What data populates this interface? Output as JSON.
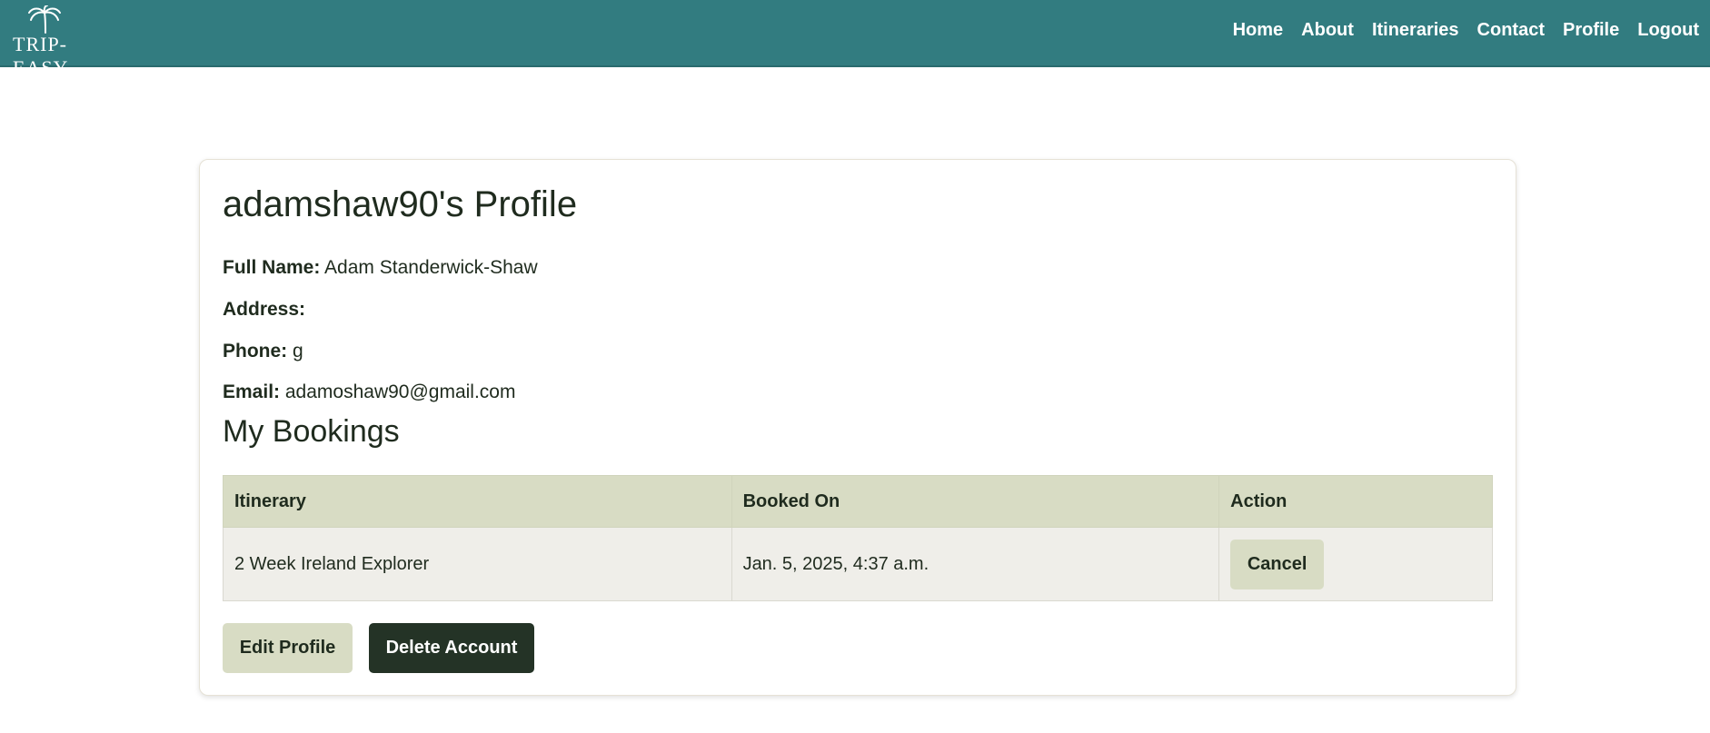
{
  "brand": {
    "logo_text": "TRIP-EASY"
  },
  "nav": {
    "items": [
      {
        "label": "Home"
      },
      {
        "label": "About"
      },
      {
        "label": "Itineraries"
      },
      {
        "label": "Contact"
      },
      {
        "label": "Profile"
      },
      {
        "label": "Logout"
      }
    ]
  },
  "profile": {
    "title": "adamshaw90's Profile",
    "full_name_label": "Full Name:",
    "full_name": "Adam Standerwick-Shaw",
    "address_label": "Address:",
    "address": "",
    "phone_label": "Phone:",
    "phone": "g",
    "email_label": "Email:",
    "email": "adamoshaw90@gmail.com"
  },
  "bookings": {
    "title": "My Bookings",
    "columns": [
      "Itinerary",
      "Booked On",
      "Action"
    ],
    "rows": [
      {
        "itinerary": "2 Week Ireland Explorer",
        "booked_on": "Jan. 5, 2025, 4:37 a.m.",
        "action_label": "Cancel"
      }
    ]
  },
  "actions": {
    "edit_label": "Edit Profile",
    "delete_label": "Delete Account"
  },
  "colors": {
    "navbar": "#327c80",
    "header_row": "#d8dcc4",
    "body_row": "#efeee9",
    "delete_button": "#243326"
  }
}
